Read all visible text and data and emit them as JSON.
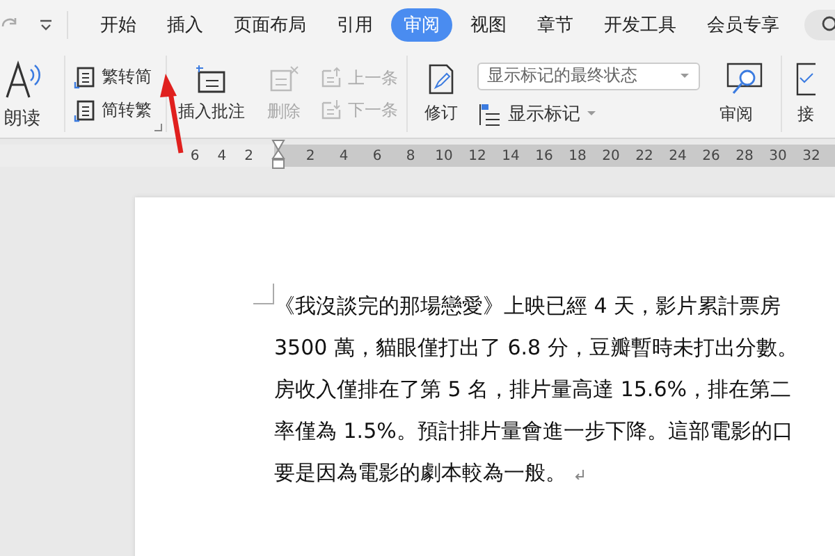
{
  "tabs": [
    {
      "label": "开始",
      "selected": false
    },
    {
      "label": "插入",
      "selected": false
    },
    {
      "label": "页面布局",
      "selected": false
    },
    {
      "label": "引用",
      "selected": false
    },
    {
      "label": "审阅",
      "selected": true
    },
    {
      "label": "视图",
      "selected": false
    },
    {
      "label": "章节",
      "selected": false
    },
    {
      "label": "开发工具",
      "selected": false
    },
    {
      "label": "会员专享",
      "selected": false
    }
  ],
  "ribbon": {
    "read_aloud": "朗读",
    "convert": [
      "繁转简",
      "简转繁"
    ],
    "insert_comment": {
      "label": "插入批注",
      "disabled": false
    },
    "delete": {
      "label": "删除",
      "disabled": true
    },
    "previous": {
      "label": "上一条",
      "disabled": true
    },
    "next": {
      "label": "下一条",
      "disabled": true
    },
    "track_changes": "修订",
    "markup_select": {
      "value": "显示标记的最终状态"
    },
    "show_markup": "显示标记",
    "review": "审阅",
    "accept": "接"
  },
  "ruler": {
    "left_ticks": [
      "6",
      "4",
      "2"
    ],
    "right_ticks": [
      "2",
      "4",
      "6",
      "8",
      "10",
      "12",
      "14",
      "16",
      "18",
      "20",
      "22",
      "24",
      "26",
      "28",
      "30",
      "32"
    ]
  },
  "document": {
    "lines": [
      "《我沒談完的那場戀愛》上映已經 4 天，影片累計票房",
      "3500 萬，貓眼僅打出了 6.8 分，豆瓣暫時未打出分數。",
      "房收入僅排在了第 5 名，排片量高達 15.6%，排在第二",
      "率僅為 1.5%。預計排片量會進一步下降。這部電影的口",
      "要是因為電影的劇本較為一般。"
    ]
  }
}
